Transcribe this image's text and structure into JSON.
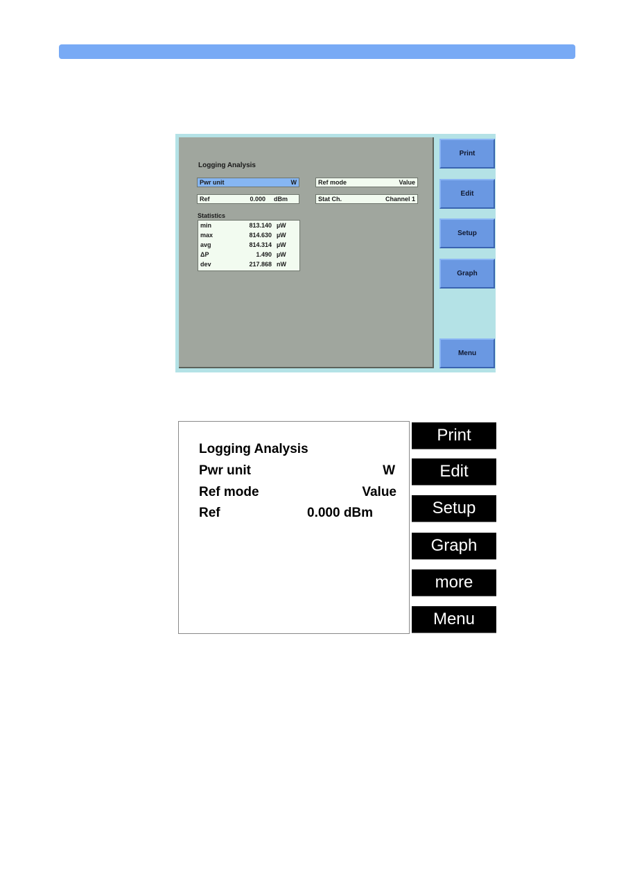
{
  "header": {
    "bar_color": "#78aaf5"
  },
  "color_screen": {
    "title": "Logging Analysis",
    "fields": {
      "pwr_unit": {
        "label": "Pwr unit",
        "value": "W",
        "selected": true
      },
      "ref_mode": {
        "label": "Ref mode",
        "value": "Value"
      },
      "ref": {
        "label": "Ref",
        "value": "0.000",
        "unit": "dBm"
      },
      "stat_ch": {
        "label": "Stat Ch.",
        "value": "Channel 1"
      }
    },
    "statistics": {
      "title": "Statistics",
      "rows": [
        {
          "name": "min",
          "value": "813.140",
          "unit": "µW"
        },
        {
          "name": "max",
          "value": "814.630",
          "unit": "µW"
        },
        {
          "name": "avg",
          "value": "814.314",
          "unit": "µW"
        },
        {
          "name": "ΔP",
          "value": "1.490",
          "unit": "µW"
        },
        {
          "name": "dev",
          "value": "217.868",
          "unit": "nW"
        }
      ]
    },
    "softkeys": [
      "Print",
      "Edit",
      "Setup",
      "Graph",
      "Menu"
    ]
  },
  "mono_screen": {
    "title": "Logging Analysis",
    "rows": [
      {
        "label": "Pwr unit",
        "value": "W"
      },
      {
        "label": "Ref mode",
        "value": "Value"
      },
      {
        "label": "Ref",
        "value": "0.000 dBm"
      }
    ],
    "softkeys": [
      "Print",
      "Edit",
      "Setup",
      "Graph",
      "more",
      "Menu"
    ]
  }
}
